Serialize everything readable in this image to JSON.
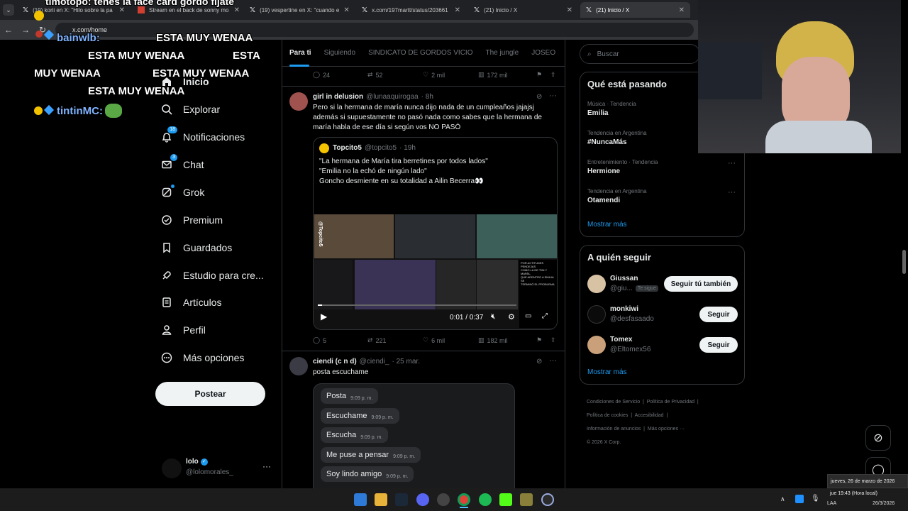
{
  "browser": {
    "tabs": [
      {
        "title": "(19) korii en X: \"Hilo sobre la pa",
        "icon": "x-logo-icon"
      },
      {
        "title": "Stream en el back de sonny mo",
        "icon": "stream-icon"
      },
      {
        "title": "(19) vespertine en X: \"cuando e",
        "icon": "x-logo-icon"
      },
      {
        "title": "x.com/197martt/status/203661",
        "icon": "x-logo-icon"
      },
      {
        "title": "(21) Inicio / X",
        "icon": "x-logo-icon"
      },
      {
        "title": "(21) Inicio / X",
        "icon": "x-logo-icon"
      }
    ],
    "url": "x.com/home"
  },
  "overlay": {
    "top_line": "timotopo: tenes la face card gordo fijate",
    "user1": "bainwlb:",
    "msg": "ESTA MUY WENAA",
    "msg_word": "ESTA",
    "msg_line2": "MUY WENAA",
    "user2": "tintinMC:"
  },
  "nav": {
    "items": [
      {
        "label": "Inicio",
        "icon": "home-icon",
        "badge": ""
      },
      {
        "label": "Explorar",
        "icon": "search-icon",
        "badge": ""
      },
      {
        "label": "Notificaciones",
        "icon": "bell-icon",
        "badge": "18"
      },
      {
        "label": "Chat",
        "icon": "mail-icon",
        "badge": "3"
      },
      {
        "label": "Grok",
        "icon": "grok-icon",
        "badge": ""
      },
      {
        "label": "Premium",
        "icon": "verified-icon",
        "badge": ""
      },
      {
        "label": "Guardados",
        "icon": "bookmark-icon",
        "badge": ""
      },
      {
        "label": "Estudio para cre...",
        "icon": "rocket-icon",
        "badge": ""
      },
      {
        "label": "Artículos",
        "icon": "article-icon",
        "badge": ""
      },
      {
        "label": "Perfil",
        "icon": "person-icon",
        "badge": ""
      },
      {
        "label": "Más opciones",
        "icon": "more-circle-icon",
        "badge": ""
      }
    ],
    "post_button": "Postear",
    "account": {
      "name": "lolo",
      "handle": "@lolomorales_"
    }
  },
  "feed": {
    "tabs": [
      "Para ti",
      "Siguiendo",
      "SINDICATO DE GORDOS VICIO",
      "The jungle",
      "JOSEO"
    ],
    "top_actions": {
      "replies": "24",
      "reposts": "52",
      "likes": "2 mil",
      "views": "172 mil"
    },
    "tweet1": {
      "name": "girl in delusion",
      "handle": "@lunaaquirogaa",
      "time": "· 8h",
      "text": [
        "Pero si la hermana de maría nunca dijo nada de un cumpleaños jajajsj",
        "además si supuestamente no pasó nada como sabes que la hermana de",
        "maría habla de ese día si según vos NO PASÓ"
      ],
      "quote": {
        "name": "Topcito5",
        "handle": "@topcito5",
        "time": "· 19h",
        "text": [
          "\"La hermana de María tira berretines por todos lados\"",
          "\"Emilia no la echó de ningún lado\"",
          "Goncho desmiente en su totalidad a Ailin Becerra👀"
        ],
        "video_time": "0:01 / 0:37",
        "video_overlay_text": [
          "POR ACTITUDES PENDEJAS",
          "COMO LA DE TINI Y MARÍA,",
          "QUE ADENTRO A EMILIA SE",
          "TERMINÓ EL PROBLEMA"
        ],
        "watermark": "@Topcito5"
      },
      "actions": {
        "replies": "5",
        "reposts": "221",
        "likes": "6 mil",
        "views": "182 mil"
      }
    },
    "tweet2": {
      "name": "ciendi (c n d)",
      "handle": "@ciendi_",
      "time": "· 25 mar.",
      "text": "posta escuchame",
      "chat_bubbles": [
        {
          "text": "Posta",
          "time": "9:09 p. m."
        },
        {
          "text": "Escuchame",
          "time": "9:09 p. m."
        },
        {
          "text": "Escucha",
          "time": "9:09 p. m."
        },
        {
          "text": "Me puse a pensar",
          "time": "9:09 p. m."
        },
        {
          "text": "Soy lindo amigo",
          "time": "9:09 p. m."
        }
      ]
    }
  },
  "right": {
    "search_placeholder": "Buscar",
    "trends_title": "Qué está pasando",
    "trends": [
      {
        "meta": "Música · Tendencia",
        "name": "Emilia"
      },
      {
        "meta": "Tendencia en Argentina",
        "name": "#NuncaMás"
      },
      {
        "meta": "Entretenimiento · Tendencia",
        "name": "Hermione"
      },
      {
        "meta": "Tendencia en Argentina",
        "name": "Otamendi"
      }
    ],
    "trends_more": "Mostrar más",
    "follow_title": "A quién seguir",
    "follow": [
      {
        "name": "Giussan",
        "handle": "@giu...",
        "tag": "Te sigue",
        "button": "Seguir tú también"
      },
      {
        "name": "monkiwi",
        "handle": "@desfasaado",
        "tag": "",
        "button": "Seguir"
      },
      {
        "name": "Tomex",
        "handle": "@Eltomex56",
        "tag": "",
        "button": "Seguir"
      }
    ],
    "follow_more": "Mostrar más",
    "footer": [
      "Condiciones de Servicio",
      "Política de Privacidad",
      "Política de cookies",
      "Accesibilidad",
      "Información de anuncios",
      "Más opciones ···",
      "© 2026 X Corp."
    ]
  },
  "system": {
    "date_tooltip": "jueves, 26 de marzo de 2026",
    "time_tooltip": "jue 19:43 (Hora local)",
    "lang": "LAA",
    "date_short": "26/3/2026"
  },
  "colors": {
    "accent": "#1d9bf0",
    "background": "#000000",
    "border": "#2f3336",
    "muted": "#71767b"
  }
}
